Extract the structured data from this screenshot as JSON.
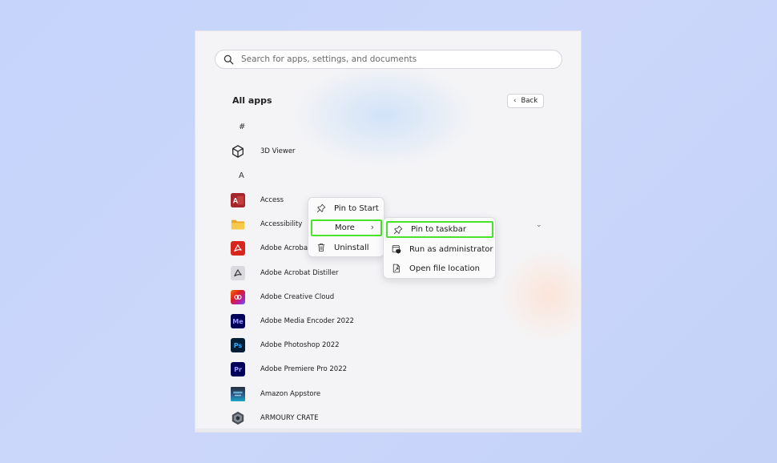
{
  "search": {
    "placeholder": "Search for apps, settings, and documents"
  },
  "header": {
    "title": "All apps",
    "back_label": "Back"
  },
  "letters": [
    "#",
    "A"
  ],
  "apps": [
    {
      "name": "3D Viewer",
      "icon": "cube-icon",
      "color": "#ffffff"
    },
    {
      "name": "Access",
      "icon": "access-icon",
      "color": "#a4262c"
    },
    {
      "name": "Accessibility",
      "icon": "folder-icon",
      "color": "#f5c242"
    },
    {
      "name": "Adobe Acrobat",
      "icon": "acrobat-icon",
      "color": "#d7261e"
    },
    {
      "name": "Adobe Acrobat Distiller",
      "icon": "distiller-icon",
      "color": "#d9d9de"
    },
    {
      "name": "Adobe Creative Cloud",
      "icon": "creative-cloud-icon",
      "color": "#da1f26"
    },
    {
      "name": "Adobe Media Encoder 2022",
      "icon": "media-encoder-icon",
      "color": "#00005b",
      "glyph": "Me",
      "glyph_color": "#9999ff"
    },
    {
      "name": "Adobe Photoshop 2022",
      "icon": "photoshop-icon",
      "color": "#001e36",
      "glyph": "Ps",
      "glyph_color": "#31a8ff"
    },
    {
      "name": "Adobe Premiere Pro 2022",
      "icon": "premiere-icon",
      "color": "#00005b",
      "glyph": "Pr",
      "glyph_color": "#9999ff"
    },
    {
      "name": "Amazon Appstore",
      "icon": "amazon-appstore-icon",
      "color": "#232f3e"
    },
    {
      "name": "ARMOURY CRATE",
      "icon": "armoury-crate-icon",
      "color": "#5a5f66"
    }
  ],
  "context_menu": {
    "items": [
      {
        "label": "Pin to Start",
        "icon": "pin-icon"
      },
      {
        "label": "More",
        "icon": "none"
      },
      {
        "label": "Uninstall",
        "icon": "trash-icon"
      }
    ]
  },
  "submenu": {
    "items": [
      {
        "label": "Pin to taskbar",
        "icon": "pin-icon"
      },
      {
        "label": "Run as administrator",
        "icon": "admin-shield-icon"
      },
      {
        "label": "Open file location",
        "icon": "file-location-icon"
      }
    ]
  },
  "colors": {
    "highlight": "#49e32c",
    "background": "#c6d4fb"
  }
}
